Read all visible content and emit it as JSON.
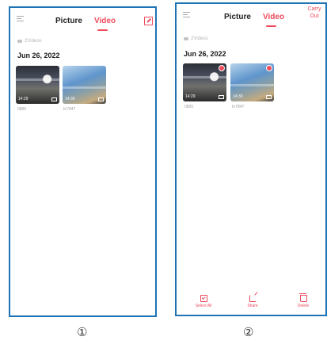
{
  "screen1": {
    "tabs": {
      "picture": "Picture",
      "video": "Video"
    },
    "count_label": "2Videos",
    "date": "Jun 26, 2022",
    "items": [
      {
        "duration": "14:29",
        "caption": "0895"
      },
      {
        "duration": "14:30",
        "caption": "In7847"
      }
    ],
    "label": "①"
  },
  "screen2": {
    "tabs": {
      "picture": "Picture",
      "video": "Video"
    },
    "carry_out": "Carry Out",
    "count_label": "2Videos",
    "date": "Jun 26, 2022",
    "items": [
      {
        "duration": "14:29",
        "caption": "0895",
        "selected": true
      },
      {
        "duration": "14:30",
        "caption": "In7847",
        "selected": true
      }
    ],
    "actions": {
      "select_all": "Select All",
      "share": "Share",
      "delete": "Delete"
    },
    "label": "②"
  },
  "colors": {
    "accent": "#ef4b5b",
    "frame": "#1e73b5"
  },
  "icons": [
    "menu-icon",
    "edit-icon",
    "folder-icon",
    "select-all-icon",
    "share-icon",
    "delete-icon"
  ]
}
